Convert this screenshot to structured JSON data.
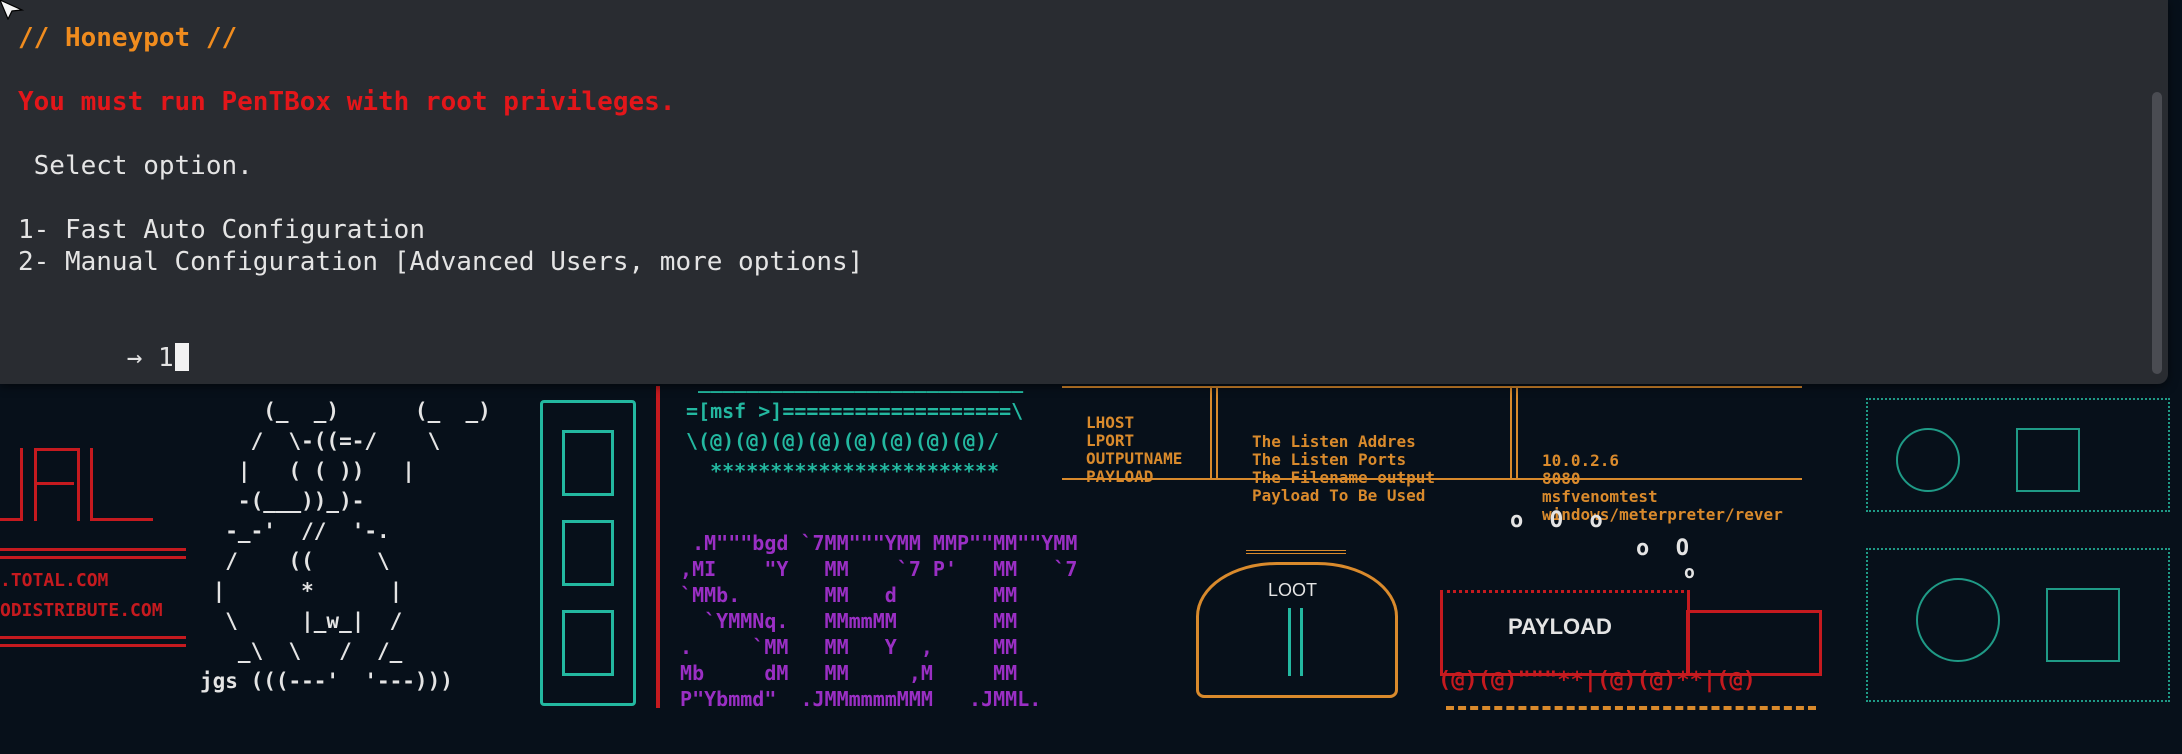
{
  "terminal": {
    "banner": "// Honeypot //",
    "warning": "You must run PenTBox with root privileges.",
    "prompt": " Select option.",
    "options": [
      "1- Fast Auto Configuration",
      "2- Manual Configuration [Advanced Users, more options]"
    ],
    "input_arrow": "→",
    "input_value": "1"
  },
  "wallpaper": {
    "virustotal_lines": [
      ".TOTAL.COM",
      "ODISTRIBUTE.COM"
    ],
    "teddy_art": "     (_  _)      (_  _)\n    /  \\-((=-/    \\\n   |   ( ( ))   |\n   -(___))_)-\n  -_-'  //  '-.\n  /    ((     \\\n |      *      |\n  \\     |_w_|  /\n   _\\  \\   /  /_\njgs (((---'  '---)))",
    "msf_art": " ___________________________\n=[msf >]===================\\\n\\(@)(@)(@)(@)(@)(@)(@)(@)/\n  ************************",
    "set_art": "  .M\"\"\"bgd `7MM\"\"\"YMM MMP\"\"MM\"\"YMM\n ,MI    \"Y   MM    `7 P'   MM   `7\n `MMb.       MM   d        MM\n   `YMMNq.   MMmmMM        MM\n .     `MM   MM   Y  ,     MM\n Mb     dM   MM     ,M     MM\n P\"Ybmmd\"  .JMMmmmmMMM   .JMML.",
    "table_rows": [
      [
        "LHOST",
        "The Listen Addres",
        "10.0.2.6"
      ],
      [
        "LPORT",
        "The Listen Ports",
        "8080"
      ],
      [
        "OUTPUTNAME",
        "The Filename output",
        "msfvenomtest"
      ],
      [
        "PAYLOAD",
        "Payload To Be Used",
        "windows/meterpreter/rever"
      ]
    ],
    "loot_label": "LOOT",
    "payload_label": "PAYLOAD",
    "payload_wheels": "(@)(@)\"\"\"**|(@)(@)**|(@)",
    "bubbles": [
      "o  O  o",
      "o  O",
      "o"
    ],
    "colors": {
      "background": "#07101a",
      "terminal": "#2c2e34",
      "red": "#c51a1f",
      "teal": "#23b8a0",
      "purple": "#9a2fc4",
      "orange": "#d98a2c"
    }
  }
}
